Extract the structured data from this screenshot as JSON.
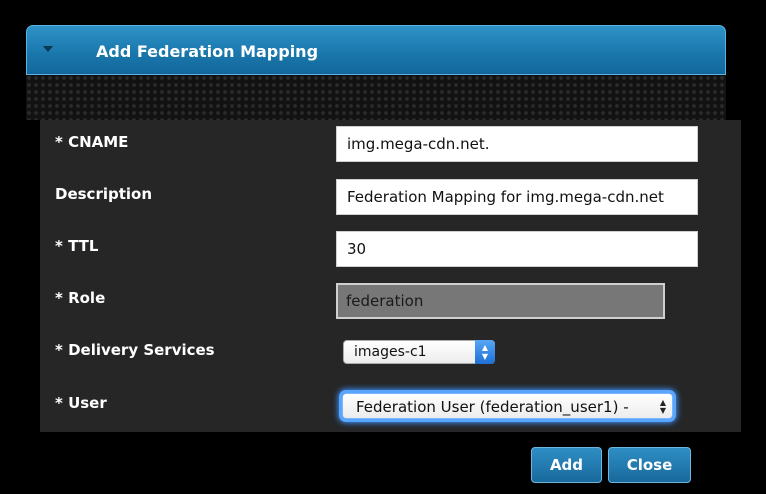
{
  "dialog": {
    "title": "Add Federation Mapping",
    "collapse_icon": "caret-down-icon"
  },
  "form": {
    "cname": {
      "label": "* CNAME",
      "value": "img.mega-cdn.net."
    },
    "description": {
      "label": "Description",
      "value": "Federation Mapping for img.mega-cdn.net"
    },
    "ttl": {
      "label": "* TTL",
      "value": "30"
    },
    "role": {
      "label": "* Role",
      "value": "federation"
    },
    "delivery_services": {
      "label": "* Delivery Services",
      "selected": "images-c1",
      "stepper_up": "▲",
      "stepper_down": "▼"
    },
    "user": {
      "label": "* User",
      "selected": "Federation User (federation_user1) -",
      "stepper_up": "▲",
      "stepper_down": "▼"
    }
  },
  "buttons": {
    "add_label": "Add",
    "close_label": "Close"
  },
  "colors": {
    "header_accent": "#1a78ad",
    "focus_ring": "#5aa6ff"
  }
}
